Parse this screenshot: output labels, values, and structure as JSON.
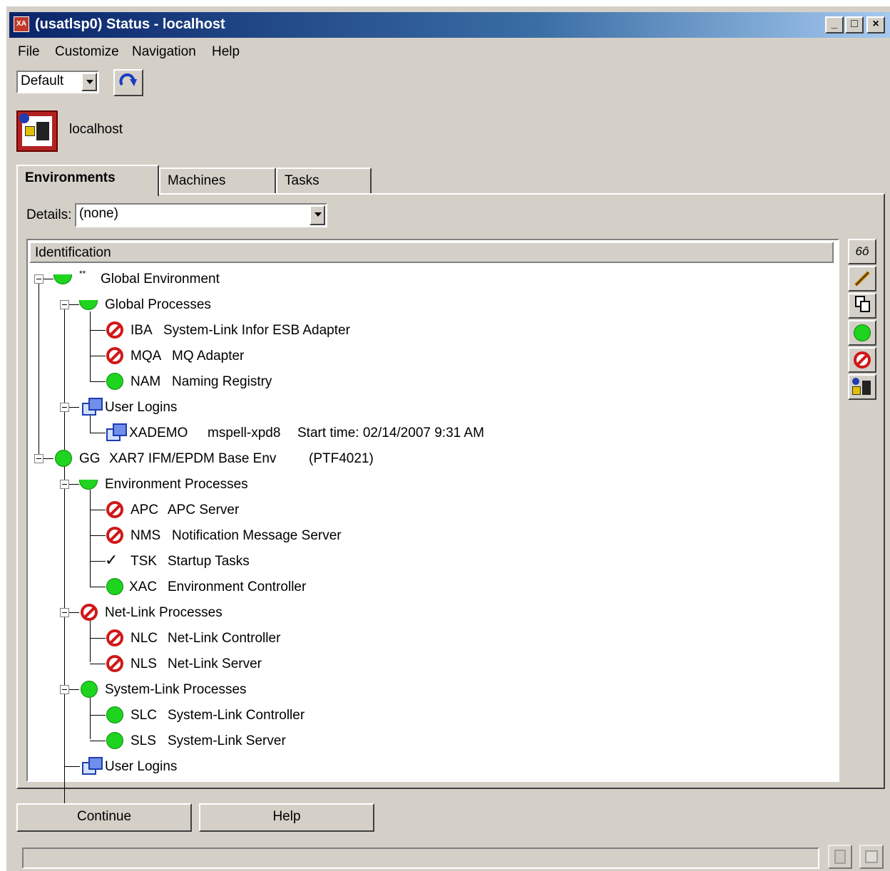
{
  "window": {
    "title": "(usatlsp0) Status - localhost",
    "app_icon_text": "XA",
    "min_symbol": "_",
    "max_symbol": "□",
    "close_symbol": "×"
  },
  "menu": [
    "File",
    "Customize",
    "Navigation",
    "Help"
  ],
  "toolbar": {
    "profile_value": "Default",
    "refresh_icon": "refresh-icon"
  },
  "host": {
    "name": "localhost"
  },
  "tabs": [
    {
      "label": "Environments",
      "active": true
    },
    {
      "label": "Machines",
      "active": false
    },
    {
      "label": "Tasks",
      "active": false
    }
  ],
  "details": {
    "label": "Details:",
    "value": "(none)"
  },
  "tree": {
    "column_header": "Identification",
    "global_env": {
      "marker": "**",
      "label": "Global Environment"
    },
    "global_processes": {
      "label": "Global Processes"
    },
    "iba": {
      "code": "IBA",
      "name": "System-Link Infor ESB Adapter"
    },
    "mqa": {
      "code": "MQA",
      "name": "MQ Adapter"
    },
    "nam": {
      "code": "NAM",
      "name": "Naming Registry"
    },
    "user_logins_1": {
      "label": "User Logins"
    },
    "xademo": {
      "code": "XADEMO",
      "machine": "mspell-xpd8",
      "start": "Start time: 02/14/2007 9:31 AM"
    },
    "gg": {
      "code": "GG",
      "name": "XAR7 IFM/EPDM Base Env",
      "ptf": "(PTF4021)"
    },
    "env_processes": {
      "label": "Environment Processes"
    },
    "apc": {
      "code": "APC",
      "name": "APC Server"
    },
    "nms": {
      "code": "NMS",
      "name": "Notification Message Server"
    },
    "tsk": {
      "code": "TSK",
      "name": "Startup Tasks"
    },
    "xac": {
      "code": "XAC",
      "name": "Environment Controller"
    },
    "netlink": {
      "label": "Net-Link Processes"
    },
    "nlc": {
      "code": "NLC",
      "name": "Net-Link Controller"
    },
    "nls": {
      "code": "NLS",
      "name": "Net-Link Server"
    },
    "syslink": {
      "label": "System-Link Processes"
    },
    "slc": {
      "code": "SLC",
      "name": "System-Link Controller"
    },
    "sls": {
      "code": "SLS",
      "name": "System-Link Server"
    },
    "user_logins_2": {
      "label": "User Logins"
    }
  },
  "buttons": {
    "continue": "Continue",
    "help": "Help"
  },
  "colors": {
    "running": "#1ed41e",
    "stopped": "#d01818",
    "title_bar": "#0a246a"
  }
}
